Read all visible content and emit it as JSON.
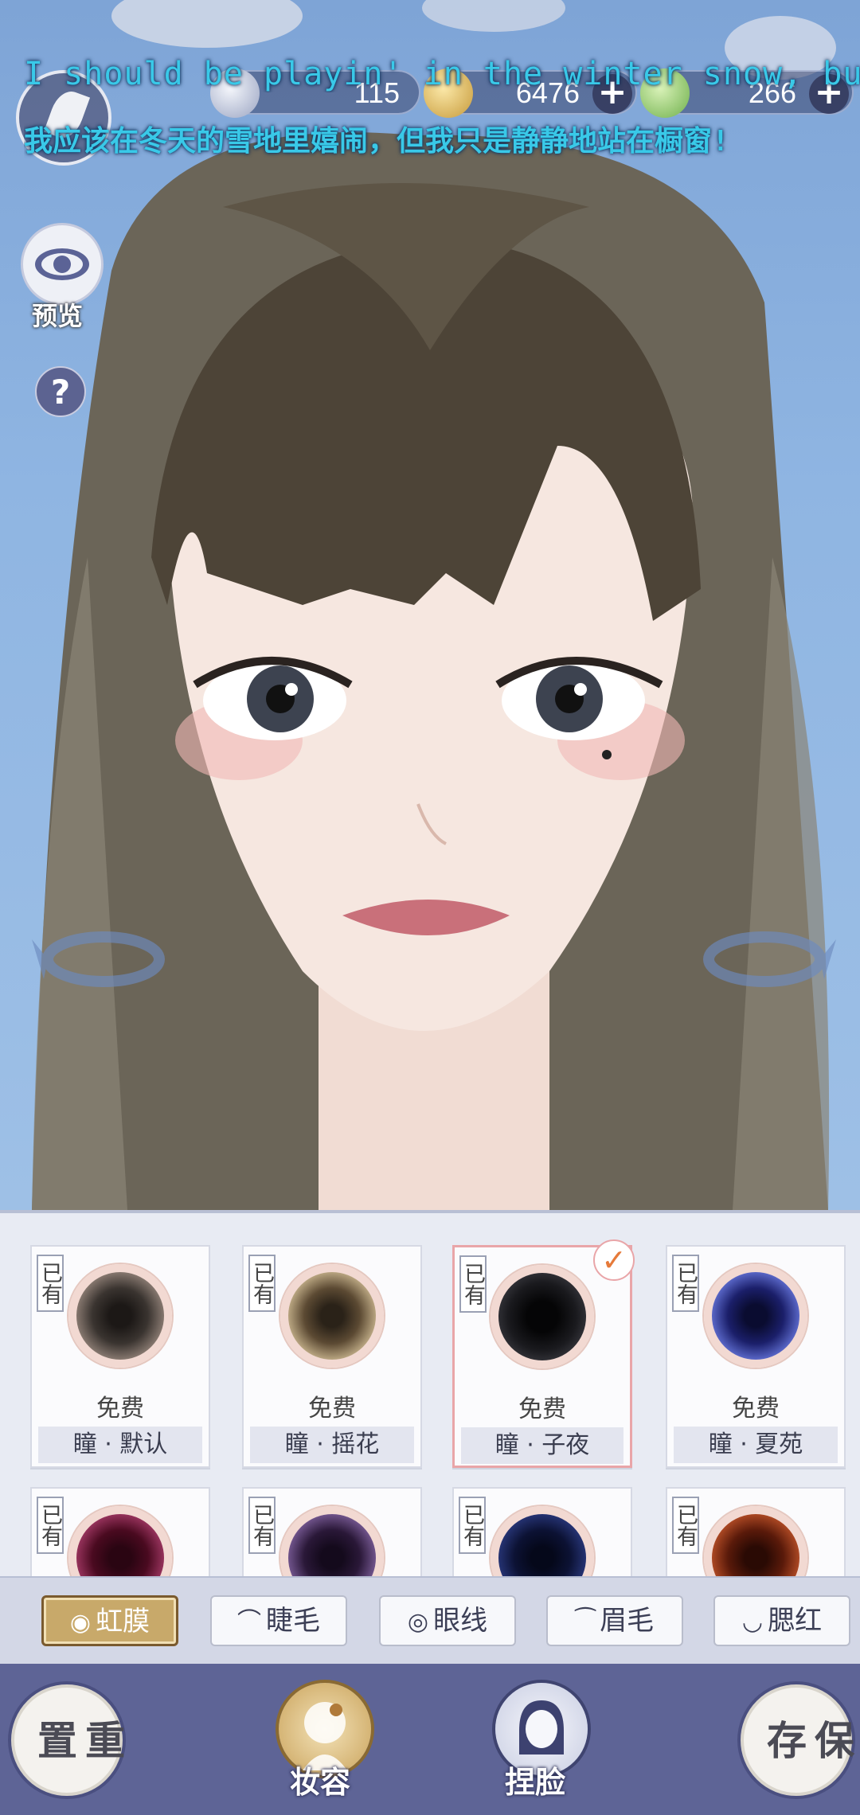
{
  "lyrics": {
    "english": "I should be playin' in the winter snow, but I'm",
    "chinese": "我应该在冬天的雪地里嬉闹，但我只是静静地站在橱窗!"
  },
  "currencies": [
    {
      "icon": "silver-coin-icon",
      "value": "115",
      "has_plus": false
    },
    {
      "icon": "gold-coin-icon",
      "value": "6476",
      "has_plus": true
    },
    {
      "icon": "jade-icon",
      "value": "266",
      "has_plus": true
    }
  ],
  "sidebar": {
    "preview_label": "预览",
    "help_label": "?"
  },
  "items": [
    {
      "owned": "已有",
      "price": "免费",
      "name": "瞳 · 默认",
      "color": "#3a3430",
      "ring": "#9b8a80",
      "selected": false
    },
    {
      "owned": "已有",
      "price": "免费",
      "name": "瞳 · 摇花",
      "color": "#4a4030",
      "ring": "#cbb68e",
      "selected": false
    },
    {
      "owned": "已有",
      "price": "免费",
      "name": "瞳 · 子夜",
      "color": "#111114",
      "ring": "#3a3a40",
      "selected": true
    },
    {
      "owned": "已有",
      "price": "免费",
      "name": "瞳 · 夏苑",
      "color": "#1b1f6a",
      "ring": "#6a7ae0",
      "selected": false
    },
    {
      "owned": "已有",
      "color": "#4a0a20",
      "ring": "#b04070"
    },
    {
      "owned": "已有",
      "color": "#2a1838",
      "ring": "#8868a8"
    },
    {
      "owned": "已有",
      "color": "#0c1234",
      "ring": "#2e3e88"
    },
    {
      "owned": "已有",
      "color": "#5a1a0a",
      "ring": "#c8582c"
    }
  ],
  "tabs": [
    {
      "label": "虹膜",
      "icon": "iris-icon",
      "active": true
    },
    {
      "label": "睫毛",
      "icon": "eyelash-icon",
      "active": false
    },
    {
      "label": "眼线",
      "icon": "eye-icon",
      "active": false
    },
    {
      "label": "眉毛",
      "icon": "eyebrow-icon",
      "active": false
    },
    {
      "label": "腮红",
      "icon": "blush-icon",
      "active": false
    }
  ],
  "bottom": {
    "reset_label": "重置",
    "save_label": "保存",
    "makeup_label": "妆容",
    "face_label": "捏脸"
  }
}
